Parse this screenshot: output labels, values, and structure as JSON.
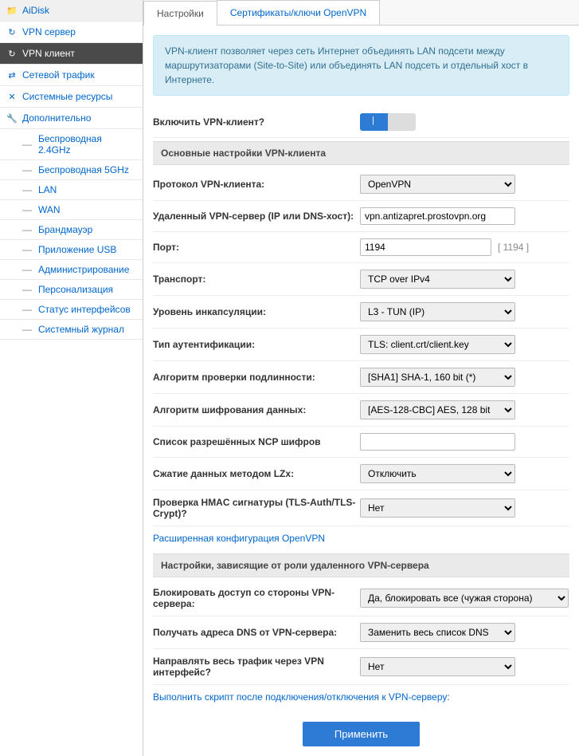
{
  "sidebar": {
    "items": [
      {
        "label": "AiDisk",
        "icon": "📁"
      },
      {
        "label": "VPN сервер",
        "icon": "↻"
      },
      {
        "label": "VPN клиент",
        "icon": "↻",
        "active": true
      },
      {
        "label": "Сетевой трафик",
        "icon": "⇄"
      },
      {
        "label": "Системные ресурсы",
        "icon": "✕"
      },
      {
        "label": "Дополнительно",
        "icon": "🔧"
      }
    ],
    "subs": [
      {
        "label": "Беспроводная 2.4GHz"
      },
      {
        "label": "Беспроводная 5GHz"
      },
      {
        "label": "LAN"
      },
      {
        "label": "WAN"
      },
      {
        "label": "Брандмауэр"
      },
      {
        "label": "Приложение USB"
      },
      {
        "label": "Администрирование"
      },
      {
        "label": "Персонализация"
      },
      {
        "label": "Статус интерфейсов"
      },
      {
        "label": "Системный журнал"
      }
    ]
  },
  "tabs": {
    "settings": "Настройки",
    "certs": "Сертификаты/ключи OpenVPN"
  },
  "info": "VPN-клиент позволяет через сеть Интернет объединять LAN подсети между маршрутизаторами (Site-to-Site) или объединять LAN подсеть и отдельный хост в Интернете.",
  "form": {
    "enable_label": "Включить VPN-клиент?",
    "section_main": "Основные настройки VPN-клиента",
    "protocol_label": "Протокол VPN-клиента:",
    "protocol_value": "OpenVPN",
    "server_label": "Удаленный VPN-сервер (IP или DNS-хост):",
    "server_value": "vpn.antizapret.prostovpn.org",
    "port_label": "Порт:",
    "port_value": "1194",
    "port_hint": "[ 1194 ]",
    "transport_label": "Транспорт:",
    "transport_value": "TCP over IPv4",
    "encap_label": "Уровень инкапсуляции:",
    "encap_value": "L3 - TUN (IP)",
    "auth_label": "Тип аутентификации:",
    "auth_value": "TLS: client.crt/client.key",
    "verify_label": "Алгоритм проверки подлинности:",
    "verify_value": "[SHA1] SHA-1, 160 bit (*)",
    "cipher_label": "Алгоритм шифрования данных:",
    "cipher_value": "[AES-128-CBC] AES, 128 bit",
    "ncp_label": "Список разрешённых NCP шифров",
    "ncp_value": "",
    "lzx_label": "Сжатие данных методом LZx:",
    "lzx_value": "Отключить",
    "hmac_label": "Проверка HMAC сигнатуры (TLS-Auth/TLS-Crypt)?",
    "hmac_value": "Нет",
    "advanced_link": "Расширенная конфигурация OpenVPN",
    "section_deps": "Настройки, зависящие от роли удаленного VPN-сервера",
    "block_label": "Блокировать доступ со стороны VPN-сервера:",
    "block_value": "Да, блокировать все (чужая сторона)",
    "dns_label": "Получать адреса DNS от VPN-сервера:",
    "dns_value": "Заменить весь список DNS",
    "route_label": "Направлять весь трафик через VPN интерфейс?",
    "route_value": "Нет",
    "script_link": "Выполнить скрипт после подключения/отключения к VPN-серверу:",
    "submit": "Применить"
  }
}
